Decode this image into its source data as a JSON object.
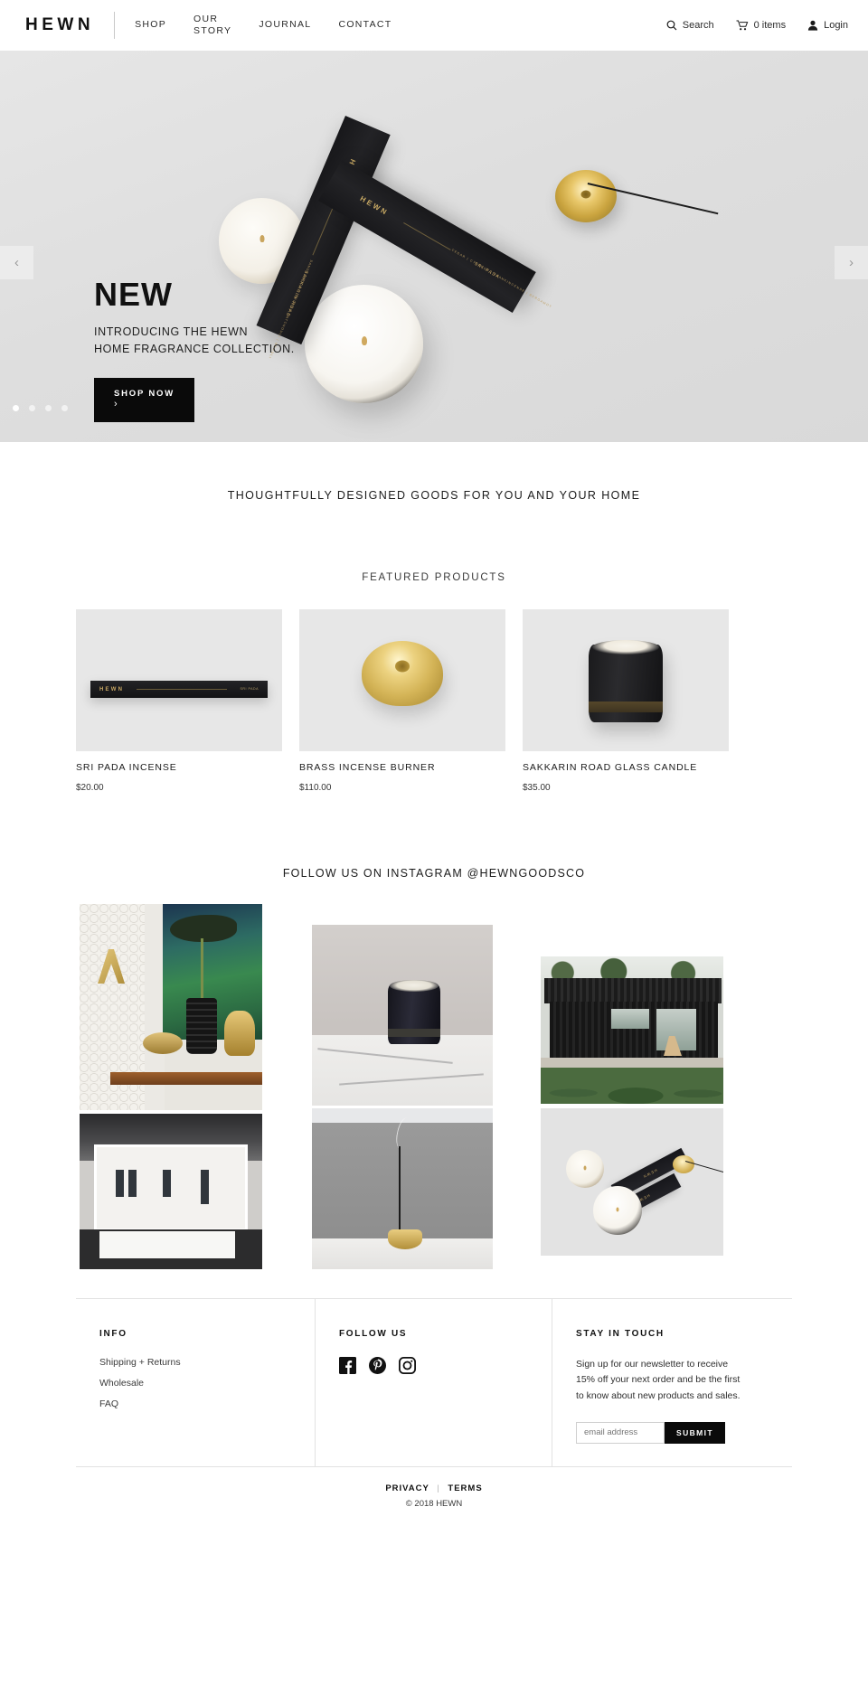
{
  "header": {
    "logo": "HEWN",
    "nav": [
      {
        "label": "SHOP"
      },
      {
        "label": "OUR\nSTORY"
      },
      {
        "label": "JOURNAL"
      },
      {
        "label": "CONTACT"
      }
    ],
    "search_label": "Search",
    "cart_label": "0 items",
    "login_label": "Login"
  },
  "hero": {
    "title": "NEW",
    "subtitle": "INTRODUCING THE HEWN\nHOME FRAGRANCE COLLECTION.",
    "button_label": "SHOP NOW",
    "button_chevron": "›",
    "prev_arrow": "‹",
    "next_arrow": "›",
    "slide_count": 4,
    "active_slide": 1,
    "photo": {
      "box1_brand": "HEWN",
      "box1_name": "SAKKARIN ROAD",
      "box1_notes": "SANDALWOOD | SMOKED PATCHOULI | NEROLI",
      "box1_qty": "20 INCENSE STICKS",
      "box2_brand": "HEWN",
      "box2_name": "SRI PADA",
      "box2_notes": "CEDAR | CYPRESS | FRANKINCENSE | BERGAMOT",
      "box2_qty": "20 INCENSE STICKS"
    }
  },
  "tagline": "THOUGHTFULLY DESIGNED GOODS FOR YOU AND YOUR HOME",
  "featured": {
    "title": "FEATURED PRODUCTS",
    "products": [
      {
        "name": "SRI PADA INCENSE",
        "price": "$20.00",
        "brand": "HEWN",
        "label_name": "SRI PADA",
        "label_notes": "CEDAR | CYPRESS | FRANKINCENSE | BERGAMOT",
        "label_qty": "20 INCENSE STICKS"
      },
      {
        "name": "BRASS INCENSE BURNER",
        "price": "$110.00"
      },
      {
        "name": "SAKKARIN ROAD GLASS CANDLE",
        "price": "$35.00"
      }
    ]
  },
  "instagram": {
    "title": "FOLLOW US ON INSTAGRAM @HEWNGOODSCO",
    "posts": [
      {
        "alt": "brass hook and shelf with plant in bathroom"
      },
      {
        "alt": "trade show booth interior"
      },
      {
        "alt": "black glass candle on marble"
      },
      {
        "alt": "incense stick burning on brass holder"
      },
      {
        "alt": "black cabin exterior with ferns"
      },
      {
        "alt": "flatlay of candles incense boxes and brass burner"
      }
    ]
  },
  "footer": {
    "info": {
      "title": "INFO",
      "links": [
        "Shipping + Returns",
        "Wholesale",
        "FAQ"
      ]
    },
    "follow": {
      "title": "FOLLOW US",
      "socials": [
        "facebook-icon",
        "pinterest-icon",
        "instagram-icon"
      ]
    },
    "newsletter": {
      "title": "STAY IN TOUCH",
      "text": "Sign up for our newsletter to receive 15% off your next order and be the first to know about new products and sales.",
      "placeholder": "email address",
      "value": "",
      "submit_label": "SUBMIT"
    },
    "bottom": {
      "privacy": "PRIVACY",
      "separator": "|",
      "terms": "TERMS",
      "copyright": "© 2018 HEWN"
    }
  }
}
